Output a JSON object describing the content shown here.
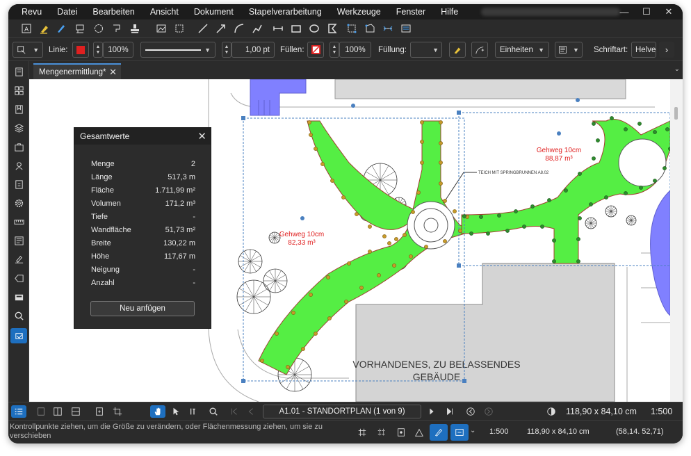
{
  "menu": [
    "Revu",
    "Datei",
    "Bearbeiten",
    "Ansicht",
    "Dokument",
    "Stapelverarbeitung",
    "Werkzeuge",
    "Fenster",
    "Hilfe"
  ],
  "window_controls": {
    "minimize": "—",
    "maximize": "☐",
    "close": "✕"
  },
  "properties_bar": {
    "line_label": "Linie:",
    "line_color": "#e02020",
    "line_opacity": "100%",
    "line_width": "1,00 pt",
    "fill_label": "Füllen:",
    "fill_opacity": "100%",
    "fill_pattern_label": "Füllung:",
    "units_label": "Einheiten",
    "font_label": "Schriftart:",
    "font_value": "Helve"
  },
  "tab": {
    "label": "Mengenermittlung*"
  },
  "totals": {
    "title": "Gesamtwerte",
    "rows": [
      {
        "key": "Menge",
        "value": "2"
      },
      {
        "key": "Länge",
        "value": "517,3 m"
      },
      {
        "key": "Fläche",
        "value": "1.711,99 m²"
      },
      {
        "key": "Volumen",
        "value": "171,2 m³"
      },
      {
        "key": "Tiefe",
        "value": "-"
      },
      {
        "key": "Wandfläche",
        "value": "51,73 m²"
      },
      {
        "key": "Breite",
        "value": "130,22 m"
      },
      {
        "key": "Höhe",
        "value": "117,67 m"
      },
      {
        "key": "Neigung",
        "value": "-"
      },
      {
        "key": "Anzahl",
        "value": "-"
      }
    ],
    "add_button": "Neu anfügen"
  },
  "drawing": {
    "label1_line1": "Gehweg 10cm",
    "label1_line2": "82,33 m³",
    "label2_line1": "Gehweg 10cm",
    "label2_line2": "88,87 m³",
    "fountain_label": "TEICH MIT SPRINGBRUNNEN A8.02",
    "building_line1": "VORHANDENES, ZU BELASSENDES",
    "building_line2": "GEBÄUDE",
    "path_color": "#55ee44",
    "markup_color": "#e02020"
  },
  "navigation": {
    "page": "A1.01 - STANDORTPLAN (1 von 9)",
    "page_size": "118,90 x 84,10 cm",
    "scale": "1:500"
  },
  "status": {
    "message": "Kontrollpunkte ziehen, um die Größe zu verändern, oder Flächenmessung ziehen, um sie zu verschieben",
    "scale": "1:500",
    "size": "118,90 x 84,10 cm",
    "coords": "(58,14. 52,71)"
  }
}
